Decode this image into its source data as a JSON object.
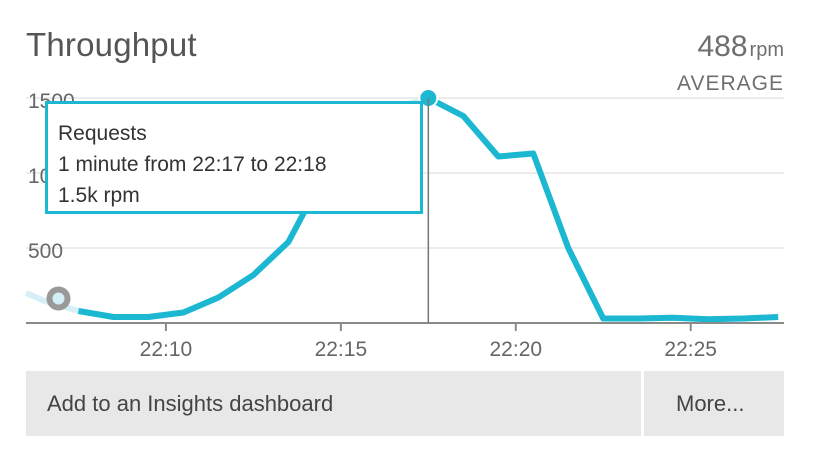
{
  "widget": {
    "title": "Throughput",
    "stat_value": "488",
    "stat_unit": "rpm",
    "stat_label": "AVERAGE"
  },
  "tooltip": {
    "line1": "Requests",
    "line2": "1 minute from 22:17 to 22:18",
    "line3": "1.5k rpm"
  },
  "actions": {
    "insights_label": "Add to an Insights dashboard",
    "more_label": "More..."
  },
  "colors": {
    "series": "#1cb8d2",
    "series_faded": "#d4f0f6",
    "grid": "#e5e5e5",
    "axis": "#8a8a8a",
    "tick_text": "#666666"
  },
  "chart_data": {
    "type": "line",
    "title": "Throughput",
    "ylabel": "",
    "xlabel": "",
    "y_unit": "rpm",
    "ylim": [
      0,
      1500
    ],
    "yticks": [
      {
        "value": 500,
        "label": "500"
      },
      {
        "value": 1000,
        "label": "1000"
      },
      {
        "value": 1500,
        "label": "1500"
      }
    ],
    "xticks": [
      {
        "value": "22:10",
        "label": "22:10"
      },
      {
        "value": "22:15",
        "label": "22:15"
      },
      {
        "value": "22:20",
        "label": "22:20"
      },
      {
        "value": "22:25",
        "label": "22:25"
      }
    ],
    "xlim": [
      "22:06:00",
      "22:27:40"
    ],
    "hover_x": "22:17:30",
    "grid": true,
    "series": [
      {
        "values": [
          {
            "x": "22:06:00",
            "y": 200
          },
          {
            "x": "22:06:30",
            "y": 150
          },
          {
            "x": "22:07:30",
            "y": 80
          },
          {
            "x": "22:08:30",
            "y": 40
          },
          {
            "x": "22:09:30",
            "y": 40
          },
          {
            "x": "22:10:30",
            "y": 70
          },
          {
            "x": "22:11:30",
            "y": 170
          },
          {
            "x": "22:12:30",
            "y": 320
          },
          {
            "x": "22:13:30",
            "y": 540
          },
          {
            "x": "22:14:30",
            "y": 980
          },
          {
            "x": "22:15:30",
            "y": 1400
          },
          {
            "x": "22:16:30",
            "y": 1430
          },
          {
            "x": "22:17:30",
            "y": 1500
          },
          {
            "x": "22:18:30",
            "y": 1380
          },
          {
            "x": "22:19:30",
            "y": 1110
          },
          {
            "x": "22:20:30",
            "y": 1130
          },
          {
            "x": "22:21:30",
            "y": 500
          },
          {
            "x": "22:22:30",
            "y": 30
          },
          {
            "x": "22:23:30",
            "y": 30
          },
          {
            "x": "22:24:30",
            "y": 35
          },
          {
            "x": "22:25:30",
            "y": 25
          },
          {
            "x": "22:26:30",
            "y": 30
          },
          {
            "x": "22:27:30",
            "y": 40
          }
        ]
      }
    ]
  }
}
